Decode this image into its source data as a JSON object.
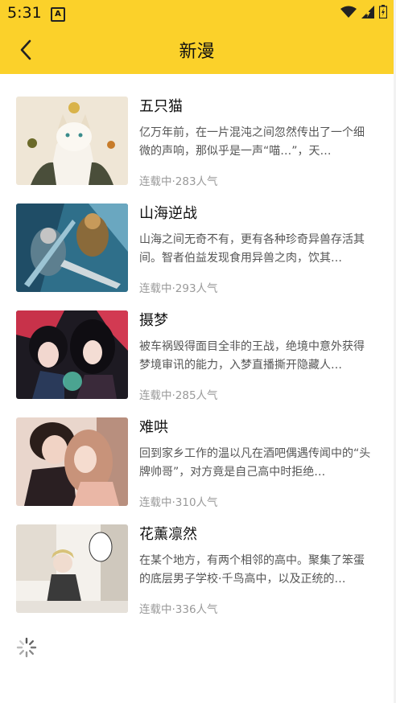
{
  "status_bar": {
    "time": "5:31",
    "notification_icon": "A"
  },
  "header": {
    "title": "新漫"
  },
  "comics": [
    {
      "name": "五只猫",
      "desc": "亿万年前，在一片混沌之间忽然传出了一个细微的声响，那似乎是一声“喵…”，天…",
      "meta": "连载中·283人气"
    },
    {
      "name": "山海逆战",
      "desc": "山海之间无奇不有，更有各种珍奇异兽存活其间。智者伯益发现食用异兽之肉，饮其…",
      "meta": "连载中·293人气"
    },
    {
      "name": "摄梦",
      "desc": "被车祸毁得面目全非的王战，绝境中意外获得梦境审讯的能力，入梦直播撕开隐藏人…",
      "meta": "连载中·285人气"
    },
    {
      "name": "难哄",
      "desc": "回到家乡工作的温以凡在酒吧偶遇传闻中的“头牌帅哥”，对方竟是自己高中时拒绝…",
      "meta": "连载中·310人气"
    },
    {
      "name": "花薰凛然",
      "desc": "在某个地方，有两个相邻的高中。聚集了笨蛋的底层男子学校·千鸟高中，以及正统的…",
      "meta": "连载中·336人气"
    }
  ],
  "colors": {
    "accent": "#fbd12a"
  }
}
